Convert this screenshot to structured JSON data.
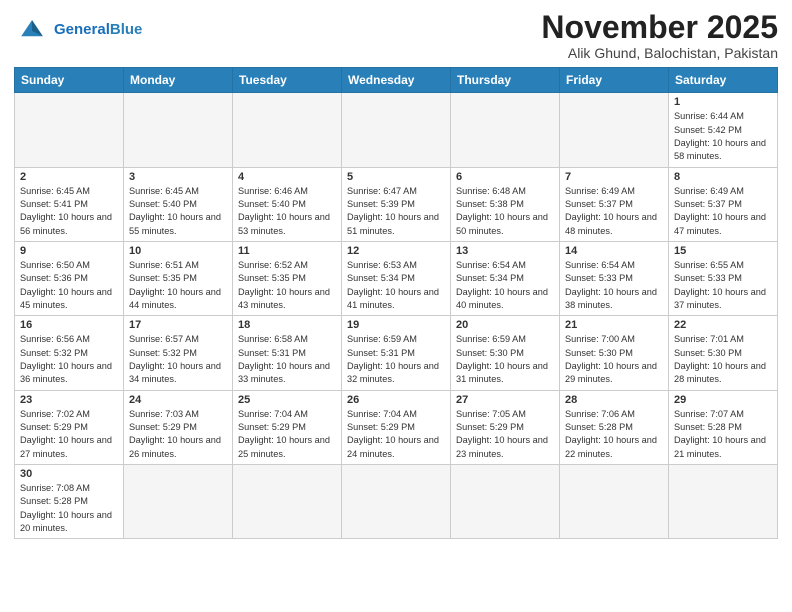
{
  "header": {
    "logo_general": "General",
    "logo_blue": "Blue",
    "month": "November 2025",
    "location": "Alik Ghund, Balochistan, Pakistan"
  },
  "days_of_week": [
    "Sunday",
    "Monday",
    "Tuesday",
    "Wednesday",
    "Thursday",
    "Friday",
    "Saturday"
  ],
  "weeks": [
    [
      {
        "day": "",
        "info": ""
      },
      {
        "day": "",
        "info": ""
      },
      {
        "day": "",
        "info": ""
      },
      {
        "day": "",
        "info": ""
      },
      {
        "day": "",
        "info": ""
      },
      {
        "day": "",
        "info": ""
      },
      {
        "day": "1",
        "info": "Sunrise: 6:44 AM\nSunset: 5:42 PM\nDaylight: 10 hours\nand 58 minutes."
      }
    ],
    [
      {
        "day": "2",
        "info": "Sunrise: 6:45 AM\nSunset: 5:41 PM\nDaylight: 10 hours\nand 56 minutes."
      },
      {
        "day": "3",
        "info": "Sunrise: 6:45 AM\nSunset: 5:40 PM\nDaylight: 10 hours\nand 55 minutes."
      },
      {
        "day": "4",
        "info": "Sunrise: 6:46 AM\nSunset: 5:40 PM\nDaylight: 10 hours\nand 53 minutes."
      },
      {
        "day": "5",
        "info": "Sunrise: 6:47 AM\nSunset: 5:39 PM\nDaylight: 10 hours\nand 51 minutes."
      },
      {
        "day": "6",
        "info": "Sunrise: 6:48 AM\nSunset: 5:38 PM\nDaylight: 10 hours\nand 50 minutes."
      },
      {
        "day": "7",
        "info": "Sunrise: 6:49 AM\nSunset: 5:37 PM\nDaylight: 10 hours\nand 48 minutes."
      },
      {
        "day": "8",
        "info": "Sunrise: 6:49 AM\nSunset: 5:37 PM\nDaylight: 10 hours\nand 47 minutes."
      }
    ],
    [
      {
        "day": "9",
        "info": "Sunrise: 6:50 AM\nSunset: 5:36 PM\nDaylight: 10 hours\nand 45 minutes."
      },
      {
        "day": "10",
        "info": "Sunrise: 6:51 AM\nSunset: 5:35 PM\nDaylight: 10 hours\nand 44 minutes."
      },
      {
        "day": "11",
        "info": "Sunrise: 6:52 AM\nSunset: 5:35 PM\nDaylight: 10 hours\nand 43 minutes."
      },
      {
        "day": "12",
        "info": "Sunrise: 6:53 AM\nSunset: 5:34 PM\nDaylight: 10 hours\nand 41 minutes."
      },
      {
        "day": "13",
        "info": "Sunrise: 6:54 AM\nSunset: 5:34 PM\nDaylight: 10 hours\nand 40 minutes."
      },
      {
        "day": "14",
        "info": "Sunrise: 6:54 AM\nSunset: 5:33 PM\nDaylight: 10 hours\nand 38 minutes."
      },
      {
        "day": "15",
        "info": "Sunrise: 6:55 AM\nSunset: 5:33 PM\nDaylight: 10 hours\nand 37 minutes."
      }
    ],
    [
      {
        "day": "16",
        "info": "Sunrise: 6:56 AM\nSunset: 5:32 PM\nDaylight: 10 hours\nand 36 minutes."
      },
      {
        "day": "17",
        "info": "Sunrise: 6:57 AM\nSunset: 5:32 PM\nDaylight: 10 hours\nand 34 minutes."
      },
      {
        "day": "18",
        "info": "Sunrise: 6:58 AM\nSunset: 5:31 PM\nDaylight: 10 hours\nand 33 minutes."
      },
      {
        "day": "19",
        "info": "Sunrise: 6:59 AM\nSunset: 5:31 PM\nDaylight: 10 hours\nand 32 minutes."
      },
      {
        "day": "20",
        "info": "Sunrise: 6:59 AM\nSunset: 5:30 PM\nDaylight: 10 hours\nand 31 minutes."
      },
      {
        "day": "21",
        "info": "Sunrise: 7:00 AM\nSunset: 5:30 PM\nDaylight: 10 hours\nand 29 minutes."
      },
      {
        "day": "22",
        "info": "Sunrise: 7:01 AM\nSunset: 5:30 PM\nDaylight: 10 hours\nand 28 minutes."
      }
    ],
    [
      {
        "day": "23",
        "info": "Sunrise: 7:02 AM\nSunset: 5:29 PM\nDaylight: 10 hours\nand 27 minutes."
      },
      {
        "day": "24",
        "info": "Sunrise: 7:03 AM\nSunset: 5:29 PM\nDaylight: 10 hours\nand 26 minutes."
      },
      {
        "day": "25",
        "info": "Sunrise: 7:04 AM\nSunset: 5:29 PM\nDaylight: 10 hours\nand 25 minutes."
      },
      {
        "day": "26",
        "info": "Sunrise: 7:04 AM\nSunset: 5:29 PM\nDaylight: 10 hours\nand 24 minutes."
      },
      {
        "day": "27",
        "info": "Sunrise: 7:05 AM\nSunset: 5:29 PM\nDaylight: 10 hours\nand 23 minutes."
      },
      {
        "day": "28",
        "info": "Sunrise: 7:06 AM\nSunset: 5:28 PM\nDaylight: 10 hours\nand 22 minutes."
      },
      {
        "day": "29",
        "info": "Sunrise: 7:07 AM\nSunset: 5:28 PM\nDaylight: 10 hours\nand 21 minutes."
      }
    ],
    [
      {
        "day": "30",
        "info": "Sunrise: 7:08 AM\nSunset: 5:28 PM\nDaylight: 10 hours\nand 20 minutes."
      },
      {
        "day": "",
        "info": ""
      },
      {
        "day": "",
        "info": ""
      },
      {
        "day": "",
        "info": ""
      },
      {
        "day": "",
        "info": ""
      },
      {
        "day": "",
        "info": ""
      },
      {
        "day": "",
        "info": ""
      }
    ]
  ]
}
